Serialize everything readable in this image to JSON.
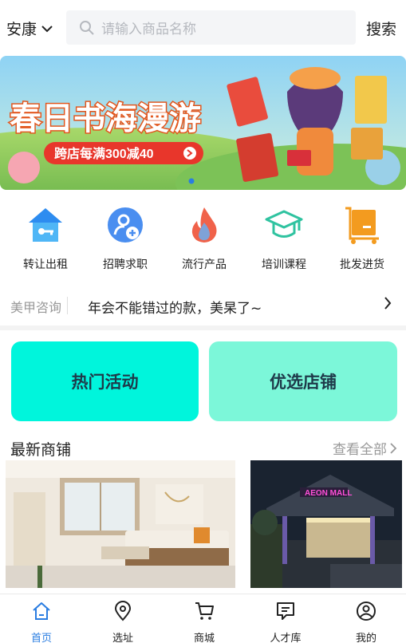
{
  "header": {
    "city": "安康",
    "search_placeholder": "请输入商品名称",
    "search_button": "搜索"
  },
  "banner": {
    "title": "春日书海漫游",
    "promo": "跨店每满300减40"
  },
  "categories": [
    {
      "label": "转让出租",
      "icon": "house-key-icon"
    },
    {
      "label": "招聘求职",
      "icon": "user-add-icon"
    },
    {
      "label": "流行产品",
      "icon": "flame-icon"
    },
    {
      "label": "培训课程",
      "icon": "graduation-cap-icon"
    },
    {
      "label": "批发进货",
      "icon": "cart-box-icon"
    }
  ],
  "notice": {
    "tag": "美甲咨询",
    "text": "年会不能错过的款，美杲了~"
  },
  "cards": {
    "hot": "热门活动",
    "preferred": "优选店铺"
  },
  "latest_shops": {
    "title": "最新商铺",
    "more": "查看全部",
    "mall_sign": "AEON MALL"
  },
  "tabs": [
    {
      "label": "首页",
      "active": true
    },
    {
      "label": "选址",
      "active": false
    },
    {
      "label": "商城",
      "active": false
    },
    {
      "label": "人才库",
      "active": false
    },
    {
      "label": "我的",
      "active": false
    }
  ],
  "colors": {
    "accent": "#2a7de1",
    "hot_card": "#00f5dc",
    "preferred_card": "#7cf7d9"
  }
}
